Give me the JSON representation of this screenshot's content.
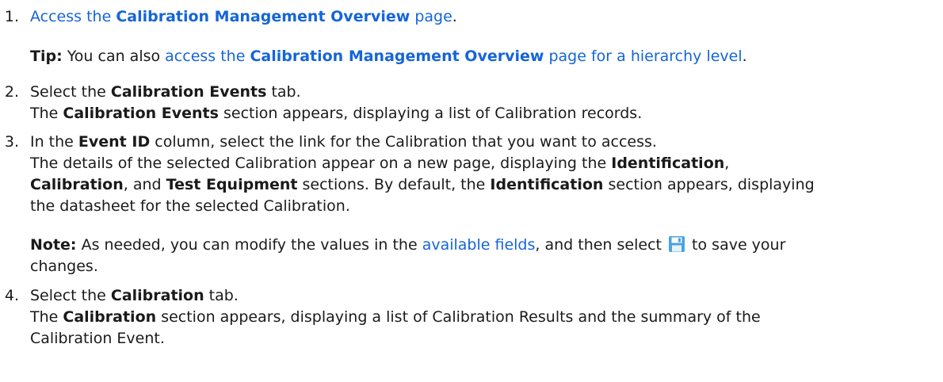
{
  "steps": [
    {
      "number": "1.",
      "link_pre": "Access the ",
      "link_bold": "Calibration Management Overview",
      "link_post": " page",
      "tail": ".",
      "tip": {
        "label": "Tip:",
        "text_pre": " You can also ",
        "link_pre": "access the ",
        "link_bold": "Calibration Management Overview",
        "link_post": " page for a hierarchy level",
        "tail": "."
      }
    },
    {
      "number": "2.",
      "pre": "Select the ",
      "bold": "Calibration Events",
      "post": " tab.",
      "result_pre": "The ",
      "result_bold": "Calibration Events",
      "result_post": " section appears, displaying a list of Calibration records."
    },
    {
      "number": "3.",
      "pre": "In the ",
      "bold": "Event ID",
      "post": " column, select the link for the Calibration that you want to access.",
      "result_l1_pre": "The details of the selected Calibration appear on a new page, displaying the ",
      "result_l1_bold": "Identification",
      "result_l1_post": ",",
      "result_l2_bold1": "Calibration",
      "result_l2_mid": ", and ",
      "result_l2_bold2": "Test Equipment",
      "result_l2_mid2": " sections. By default, the ",
      "result_l2_bold3": "Identification",
      "result_l2_post": " section appears, displaying",
      "result_l3": "the datasheet for the selected Calibration.",
      "note": {
        "label": "Note:",
        "text_pre": " As needed, you can modify the values in the ",
        "link": "available fields",
        "text_mid": ", and then select ",
        "icon": "save-icon",
        "text_post": " to save your",
        "text_l2": "changes."
      }
    },
    {
      "number": "4.",
      "pre": "Select the ",
      "bold": "Calibration",
      "post": " tab.",
      "result_l1_pre": "The ",
      "result_l1_bold": "Calibration",
      "result_l1_post": " section appears, displaying a list of Calibration Results and the summary of the",
      "result_l2": "Calibration Event."
    }
  ],
  "colors": {
    "link": "#1565d8",
    "text": "#1a1a1a",
    "icon": "#4aa3df"
  }
}
